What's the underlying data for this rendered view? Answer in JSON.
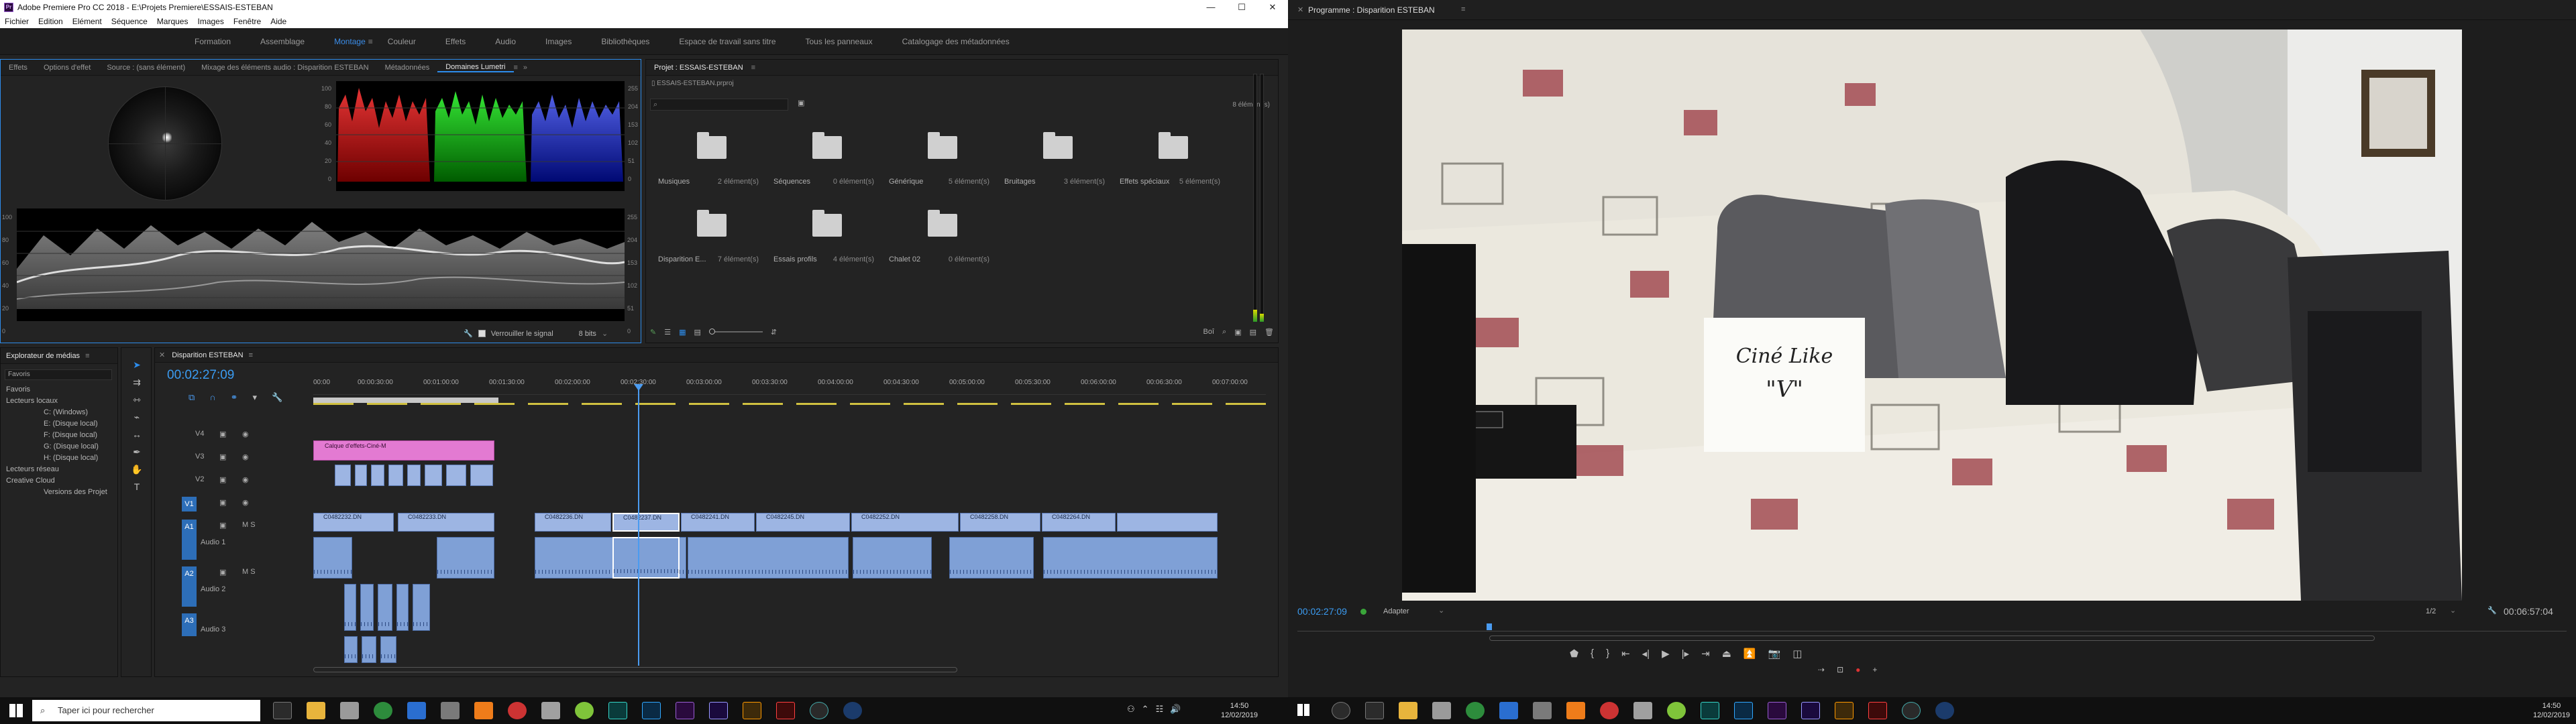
{
  "window": {
    "title": "Adobe Premiere Pro CC 2018 - E:\\Projets Premiere\\ESSAIS-ESTEBAN",
    "app_icon": "Pr",
    "buttons": [
      "—",
      "☐",
      "✕"
    ]
  },
  "menu": [
    "Fichier",
    "Edition",
    "Elément",
    "Séquence",
    "Marques",
    "Images",
    "Fenêtre",
    "Aide"
  ],
  "workspaces": {
    "items": [
      "Formation",
      "Assemblage",
      "Montage",
      "Couleur",
      "Effets",
      "Audio",
      "Images",
      "Bibliothèques",
      "Espace de travail sans titre",
      "Tous les panneaux",
      "Catalogage des métadonnées"
    ],
    "active": "Montage"
  },
  "source_panel": {
    "tabs": [
      "Effets",
      "Options d'effet",
      "Source : (sans élément)",
      "Mixage des éléments audio : Disparition ESTEBAN",
      "Métadonnées",
      "Domaines Lumetri"
    ],
    "active_tab": "Domaines Lumetri",
    "parade_scale": [
      "255",
      "204",
      "153",
      "102",
      "51",
      "0"
    ],
    "parade_scale_pct": [
      "100",
      "80",
      "60",
      "40",
      "20",
      "0"
    ],
    "waveform_left": [
      "100",
      "80",
      "60",
      "40",
      "20",
      "0"
    ],
    "waveform_right": [
      "255",
      "204",
      "153",
      "102",
      "51",
      "0"
    ],
    "clamp_label": "Verrouiller le signal",
    "bits_label": "8 bits"
  },
  "project_panel": {
    "tab": "Projet : ESSAIS-ESTEBAN",
    "file": "ESSAIS-ESTEBAN.prproj",
    "count": "8 élément(s)",
    "search_placeholder": "",
    "bins": [
      {
        "name": "Musiques",
        "count": "2 élément(s)"
      },
      {
        "name": "Séquences",
        "count": "0 élément(s)"
      },
      {
        "name": "Générique",
        "count": "5 élément(s)"
      },
      {
        "name": "Bruitages",
        "count": "3 élément(s)"
      },
      {
        "name": "Effets spéciaux",
        "count": "5 élément(s)"
      },
      {
        "name": "Disparition E...",
        "count": "7 élément(s)"
      },
      {
        "name": "Essais profils",
        "count": "4 élément(s)"
      },
      {
        "name": "Chalet 02",
        "count": "0 élément(s)"
      }
    ],
    "footer_zoom_label": "Boî"
  },
  "media_browser": {
    "tab": "Explorateur de médias",
    "favs_label": "Favoris",
    "tree": [
      "Favoris",
      "Lecteurs locaux",
      "C: (Windows)",
      "E: (Disque local)",
      "F: (Disque local)",
      "G: (Disque local)",
      "H: (Disque local)",
      "Lecteurs réseau",
      "Creative Cloud",
      "Versions des Projet"
    ]
  },
  "timeline": {
    "tab": "Disparition ESTEBAN",
    "timecode": "00:02:27:09",
    "ruler": [
      "00:00",
      "00:00:30:00",
      "00:01:00:00",
      "00:01:30:00",
      "00:02:00:00",
      "00:02:30:00",
      "00:03:00:00",
      "00:03:30:00",
      "00:04:00:00",
      "00:04:30:00",
      "00:05:00:00",
      "00:05:30:00",
      "00:06:00:00",
      "00:06:30:00",
      "00:07:00:00"
    ],
    "video_tracks": [
      "V4",
      "V3",
      "V2",
      "V1"
    ],
    "audio_tracks": [
      "A1",
      "A2",
      "A3"
    ],
    "audio_track_names": [
      "Audio 1",
      "Audio 2",
      "Audio 3"
    ],
    "title_clip": "Calque d'effets-Ciné-M",
    "v1_clips": [
      "C0482232.DN",
      "C0482233.DN",
      "C0482236.DN",
      "C0482237.DN",
      "C0482241.DN",
      "C0482245.DN",
      "C0482252.DN",
      "C0482258.DN",
      "C0482264.DN"
    ]
  },
  "program": {
    "title": "Programme : Disparition ESTEBAN",
    "timecode_left": "00:02:27:09",
    "fit": "Adapter",
    "quality": "1/2",
    "timecode_right": "00:06:57:04",
    "paper_line1": "Ciné Like",
    "paper_line2": "\"V\""
  },
  "taskbar": {
    "search_placeholder": "Taper ici pour rechercher",
    "clock_time": "14:50",
    "clock_date": "12/02/2019"
  },
  "colors": {
    "accent": "#2d8ceb",
    "video_clip": "#9db5e3",
    "audio_clip": "#7fa0d6",
    "title_clip": "#e37ad2",
    "playhead": "#4a9bf0"
  }
}
